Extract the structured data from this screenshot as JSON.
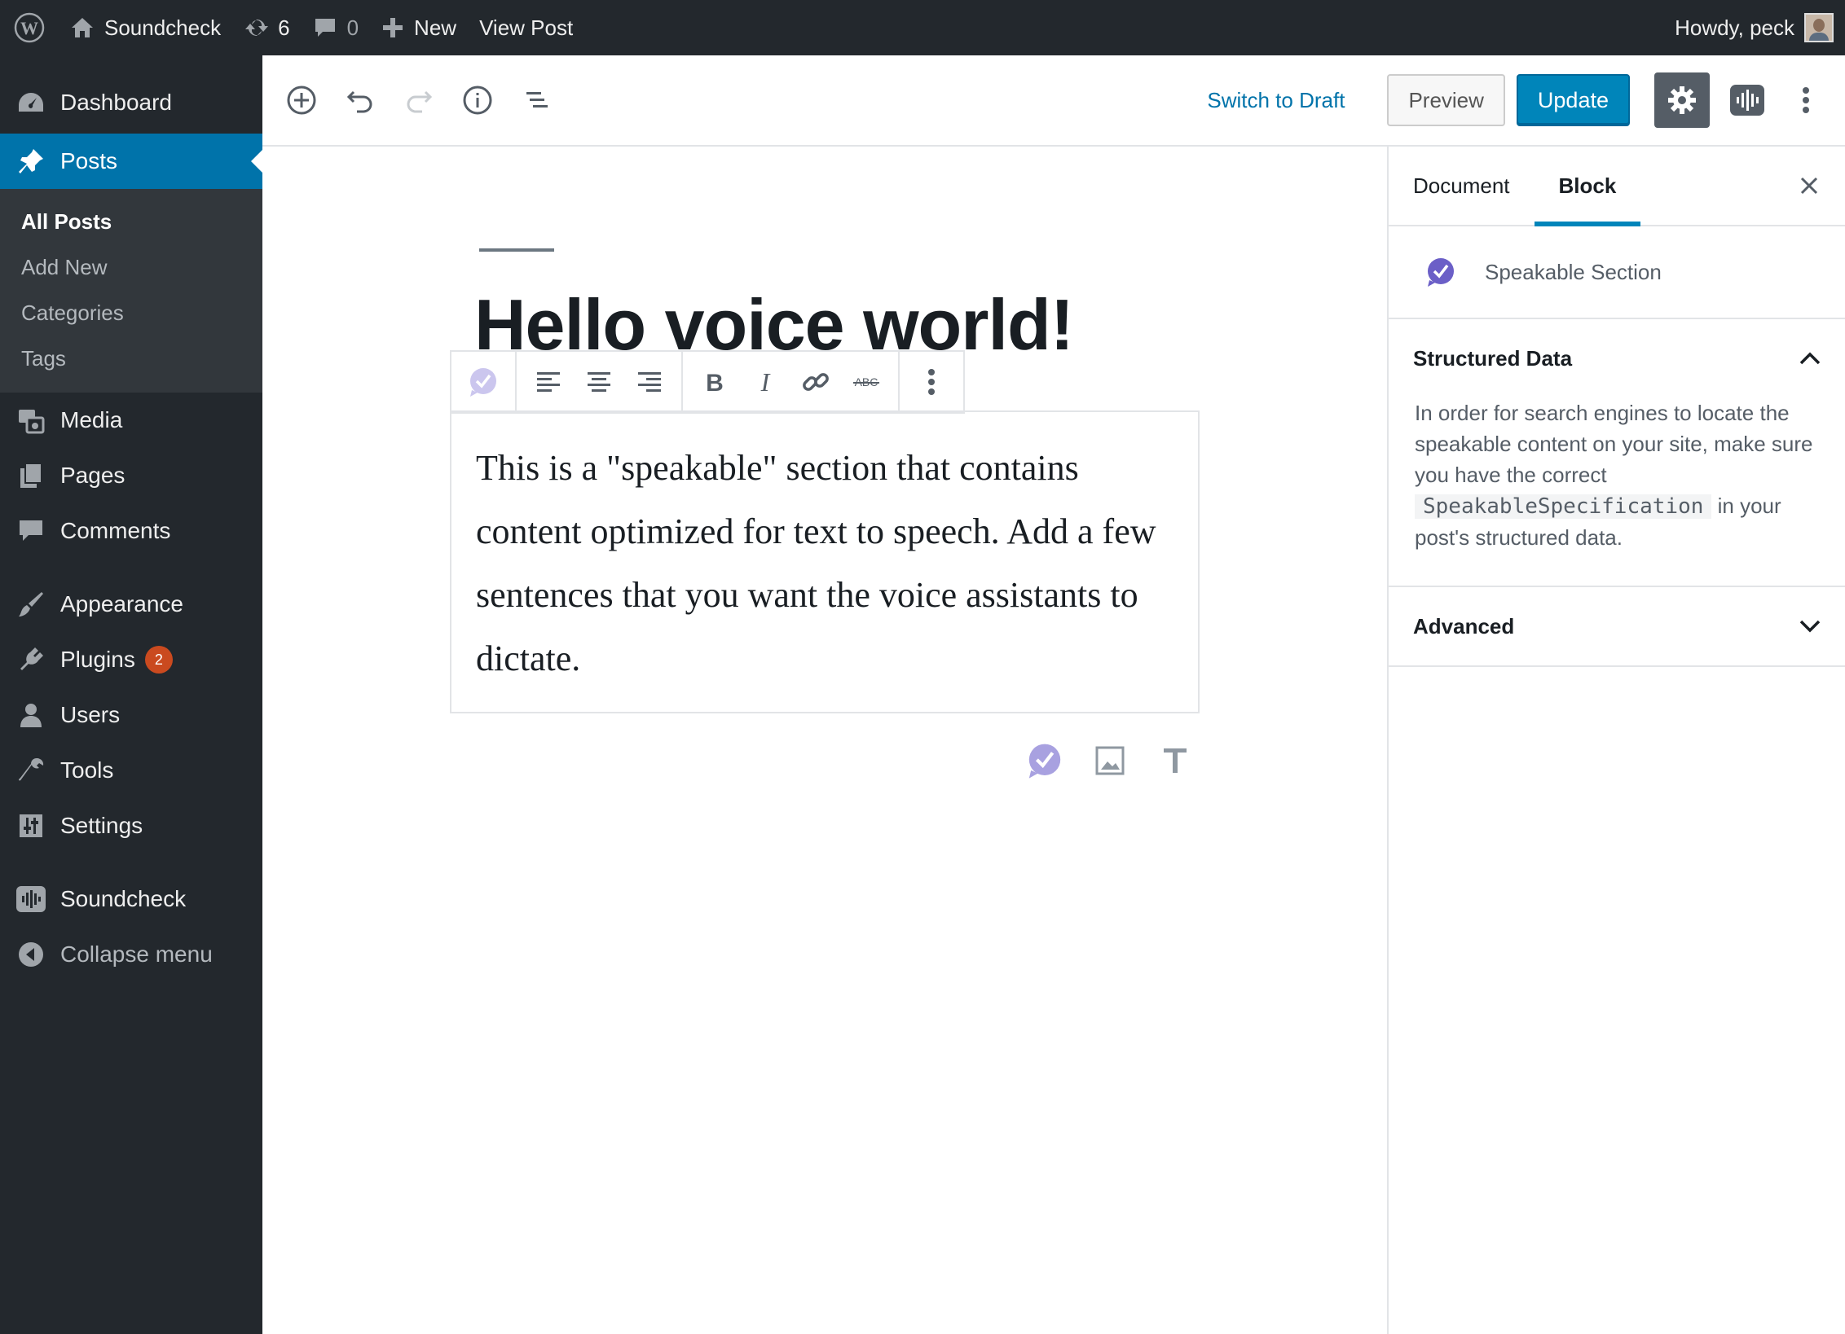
{
  "admin_bar": {
    "site_name": "Soundcheck",
    "updates_count": "6",
    "comments_count": "0",
    "new_label": "New",
    "view_post_label": "View Post",
    "greeting": "Howdy, peck"
  },
  "sidebar": {
    "dashboard": "Dashboard",
    "posts": "Posts",
    "posts_sub": [
      "All Posts",
      "Add New",
      "Categories",
      "Tags"
    ],
    "media": "Media",
    "pages": "Pages",
    "comments": "Comments",
    "appearance": "Appearance",
    "plugins": "Plugins",
    "plugins_badge": "2",
    "users": "Users",
    "tools": "Tools",
    "settings": "Settings",
    "soundcheck": "Soundcheck",
    "collapse": "Collapse menu"
  },
  "toolbar": {
    "switch_to_draft": "Switch to Draft",
    "preview": "Preview",
    "update": "Update"
  },
  "editor": {
    "post_title": "Hello voice world!",
    "speakable_text": "This is a \"speakable\" section that contains content optimized for text to speech. Add a few sentences that you want the voice assistants to dictate."
  },
  "settings_sidebar": {
    "tab_document": "Document",
    "tab_block": "Block",
    "block_name": "Speakable Section",
    "structured_data_title": "Structured Data",
    "structured_data_text_1": "In order for search engines to locate the speakable content on your site, make sure you have the correct",
    "structured_data_code": "SpeakableSpecification",
    "structured_data_text_2": "in your post's structured data.",
    "advanced_title": "Advanced"
  },
  "colors": {
    "admin_bg": "#23282d",
    "accent": "#0073aa",
    "update_button": "#0085ba",
    "speakable_purple": "#6b5fc7",
    "badge": "#ca4a1f"
  }
}
